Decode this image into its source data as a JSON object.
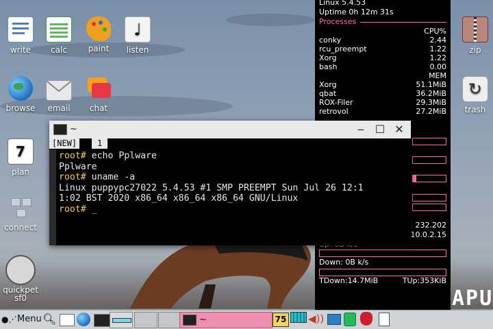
{
  "desktop": {
    "icons": [
      {
        "label": "write",
        "glyph": "write-icon"
      },
      {
        "label": "calc",
        "glyph": "calc-icon"
      },
      {
        "label": "paint",
        "glyph": "paint-icon"
      },
      {
        "label": "listen",
        "glyph": "listen-icon"
      },
      {
        "label": "browse",
        "glyph": "browse-icon"
      },
      {
        "label": "email",
        "glyph": "email-icon"
      },
      {
        "label": "chat",
        "glyph": "chat-icon"
      },
      {
        "label": "plan",
        "glyph": "plan-icon",
        "badge": "7"
      },
      {
        "label": "connect",
        "glyph": "connect-icon"
      },
      {
        "label": "quickpet",
        "sub": "sf0",
        "glyph": "quickpet-icon"
      },
      {
        "label": "zip",
        "glyph": "zip-icon"
      },
      {
        "label": "trash",
        "glyph": "trash-icon"
      }
    ],
    "wallpaper_text": "APU"
  },
  "conky": {
    "kernel": "Linux 5.4.53",
    "uptime": "Uptime 0h 12m 31s",
    "processes_title": "Processes",
    "cpu_header": "CPU%",
    "cpu_rows": [
      {
        "name": "conky",
        "value": "2.44"
      },
      {
        "name": "rcu_preempt",
        "value": "1.22"
      },
      {
        "name": "Xorg",
        "value": "1.22"
      },
      {
        "name": "bash",
        "value": "0.00"
      }
    ],
    "mem_header": "MEM",
    "mem_rows": [
      {
        "name": "Xorg",
        "value": "51.1MiB"
      },
      {
        "name": "qbat",
        "value": "36.2MiB"
      },
      {
        "name": "ROX-Filer",
        "value": "29.3MiB"
      },
      {
        "name": "retrovol",
        "value": "27.2MiB"
      }
    ],
    "bars": [
      0.0,
      0.0,
      0.1,
      0.0,
      0.0,
      0.0
    ],
    "ip_partial_1": "232.202",
    "ip_partial_2": "10.0.2.15",
    "up_partial": "Up: 0B  k/s",
    "down": "Down: 0B  k/s",
    "tdown": "TDown:14.7MiB",
    "tup": "TUp:353KiB"
  },
  "terminal": {
    "title": "~",
    "tabs": [
      "[NEW]",
      "1"
    ],
    "lines": [
      {
        "prompt": "root#",
        "text": " echo Pplware"
      },
      {
        "prompt": "",
        "text": "Pplware"
      },
      {
        "prompt": "root#",
        "text": " uname -a"
      },
      {
        "prompt": "",
        "text": "Linux puppypc27022 5.4.53 #1 SMP PREEMPT Sun Jul 26 12:1"
      },
      {
        "prompt": "",
        "text": "1:02 BST 2020 x86_64 x86_64 x86_64 GNU/Linux"
      },
      {
        "prompt": "root#",
        "text": " "
      }
    ],
    "cursor": "_"
  },
  "taskbar": {
    "menu_label": "Menu",
    "task_label": "~",
    "battery": "75"
  },
  "colors": {
    "accent_pink": "#ff6f9a",
    "prompt_yellow": "#ffd23a",
    "task_pink": "#f08fb0"
  }
}
